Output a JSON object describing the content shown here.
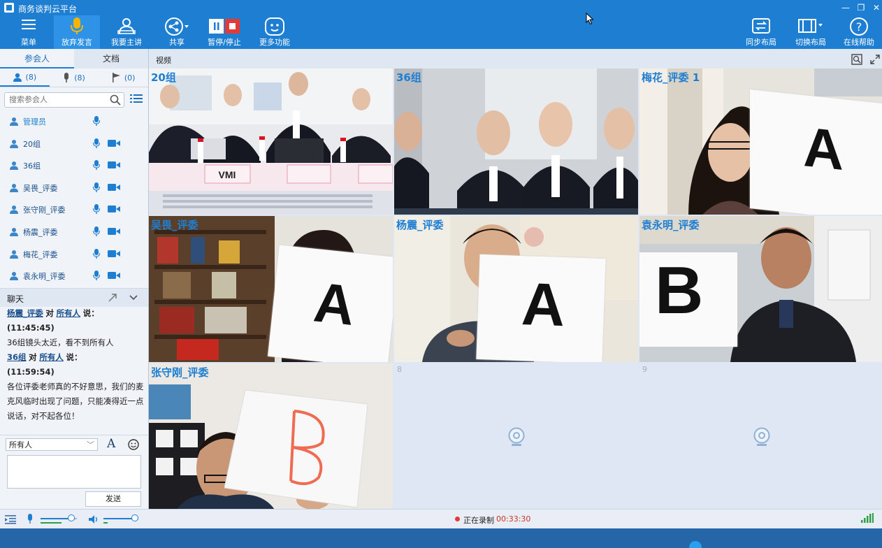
{
  "window": {
    "title": "商务谈判云平台"
  },
  "toolbar": {
    "items": [
      {
        "label": "菜单"
      },
      {
        "label": "放弃发言"
      },
      {
        "label": "我要主讲"
      },
      {
        "label": "共享"
      },
      {
        "label": "暂停/停止"
      },
      {
        "label": "更多功能"
      },
      {
        "label": "同步布局"
      },
      {
        "label": "切换布局"
      },
      {
        "label": "在线帮助"
      }
    ]
  },
  "left": {
    "tabs": [
      "参会人",
      "文档"
    ],
    "counts": [
      "(8)",
      "(8)",
      "(0)"
    ],
    "search_placeholder": "搜索参会人",
    "participants": [
      "管理员",
      "20组",
      "36组",
      "吴畏_评委",
      "张守刚_评委",
      "杨震_评委",
      "梅花_评委",
      "袁永明_评委"
    ]
  },
  "chat": {
    "title": "聊天",
    "msg1_sender": "杨震_评委",
    "msg1_to_word": "对",
    "msg1_target": "所有人",
    "msg1_says": "说：",
    "msg1_time": "(11:45:45)",
    "msg1_text": "36组镜头太近，看不到所有人",
    "msg2_sender": "36组",
    "msg2_to_word": "对",
    "msg2_target": "所有人",
    "msg2_says": "说：",
    "msg2_time": "(11:59:54)",
    "msg2_text": "各位评委老师真的不好意思，我们的麦克风临时出现了问题，只能凑得近一点说话，对不起各位！",
    "recipient": "所有人",
    "send_label": "发送"
  },
  "video": {
    "title": "视频",
    "tiles": [
      "20组",
      "36组",
      "梅花_评委 1",
      "吴畏_评委",
      "杨震_评委",
      "袁永明_评委",
      "张守刚_评委",
      "8",
      "9"
    ],
    "cards": [
      "A",
      "A",
      "A",
      "B"
    ]
  },
  "status": {
    "recording": "正在录制",
    "elapsed": "00:33:30",
    "mic_level": 0.85,
    "speaker_level": 0.9
  },
  "colors": {
    "accent": "#1e7fd2",
    "record": "#e53935",
    "signal": "#2ea043"
  }
}
